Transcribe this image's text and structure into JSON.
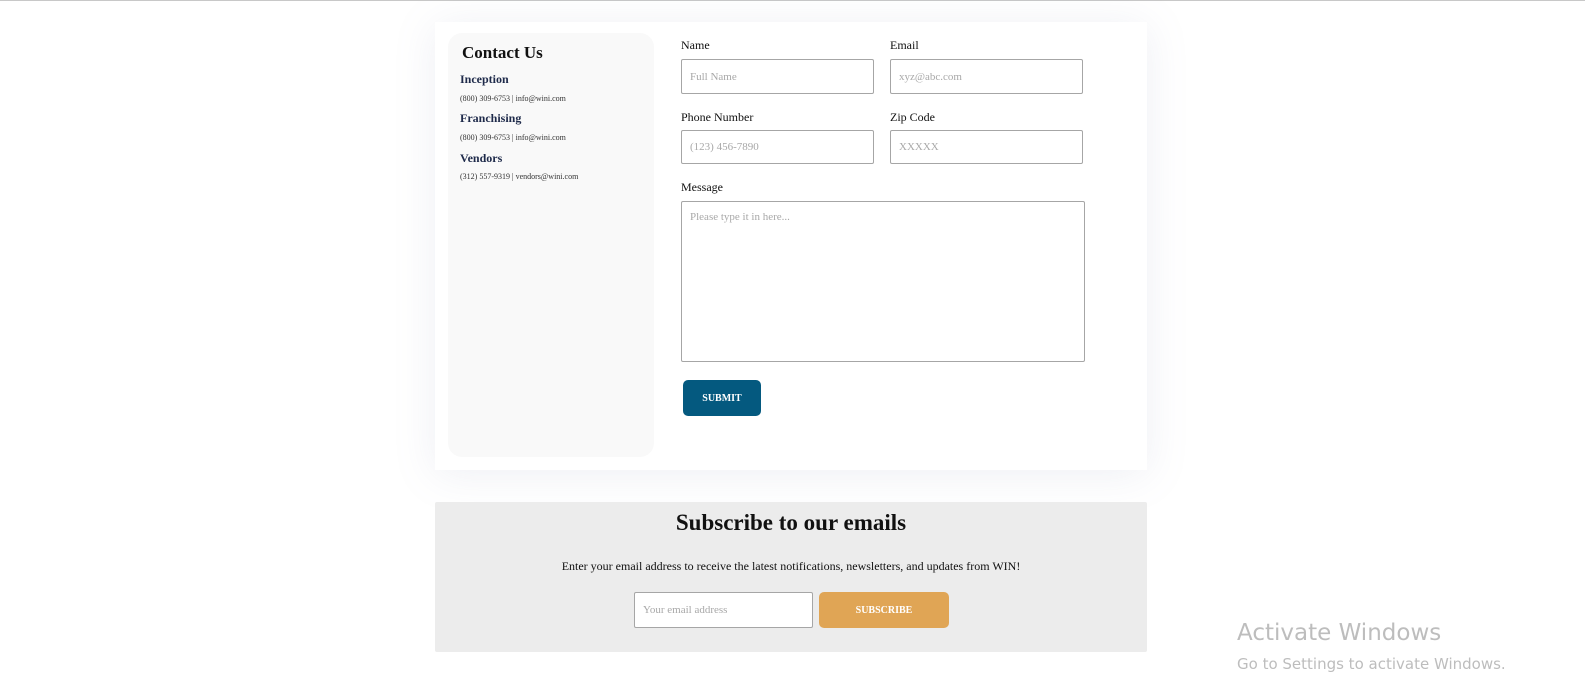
{
  "contact": {
    "title": "Contact Us",
    "departments": [
      {
        "heading": "Inception",
        "detail": "(800) 309-6753 | info@wini.com"
      },
      {
        "heading": "Franchising",
        "detail": "(800) 309-6753 | info@wini.com"
      },
      {
        "heading": "Vendors",
        "detail": "(312) 557-9319 | vendors@wini.com"
      }
    ]
  },
  "form": {
    "name": {
      "label": "Name",
      "placeholder": "Full Name",
      "value": ""
    },
    "email": {
      "label": "Email",
      "placeholder": "xyz@abc.com",
      "value": ""
    },
    "phone": {
      "label": "Phone Number",
      "placeholder": "(123) 456-7890",
      "value": ""
    },
    "zip": {
      "label": "Zip Code",
      "placeholder": "XXXXX",
      "value": ""
    },
    "message": {
      "label": "Message",
      "placeholder": "Please type it in here...",
      "value": ""
    },
    "submit_label": "SUBMIT"
  },
  "subscribe": {
    "title": "Subscribe to our emails",
    "text": "Enter your email address to receive the latest notifications, newsletters, and updates from WIN!",
    "email_placeholder": "Your email address",
    "email_value": "",
    "button_label": "SUBSCRIBE"
  },
  "watermark": {
    "title": "Activate Windows",
    "subtitle": "Go to Settings to activate Windows."
  },
  "colors": {
    "submit_bg": "#04597f",
    "subscribe_bg": "#e0a555",
    "panel_bg": "#ececec",
    "sidebar_bg": "#f9f9f9"
  }
}
